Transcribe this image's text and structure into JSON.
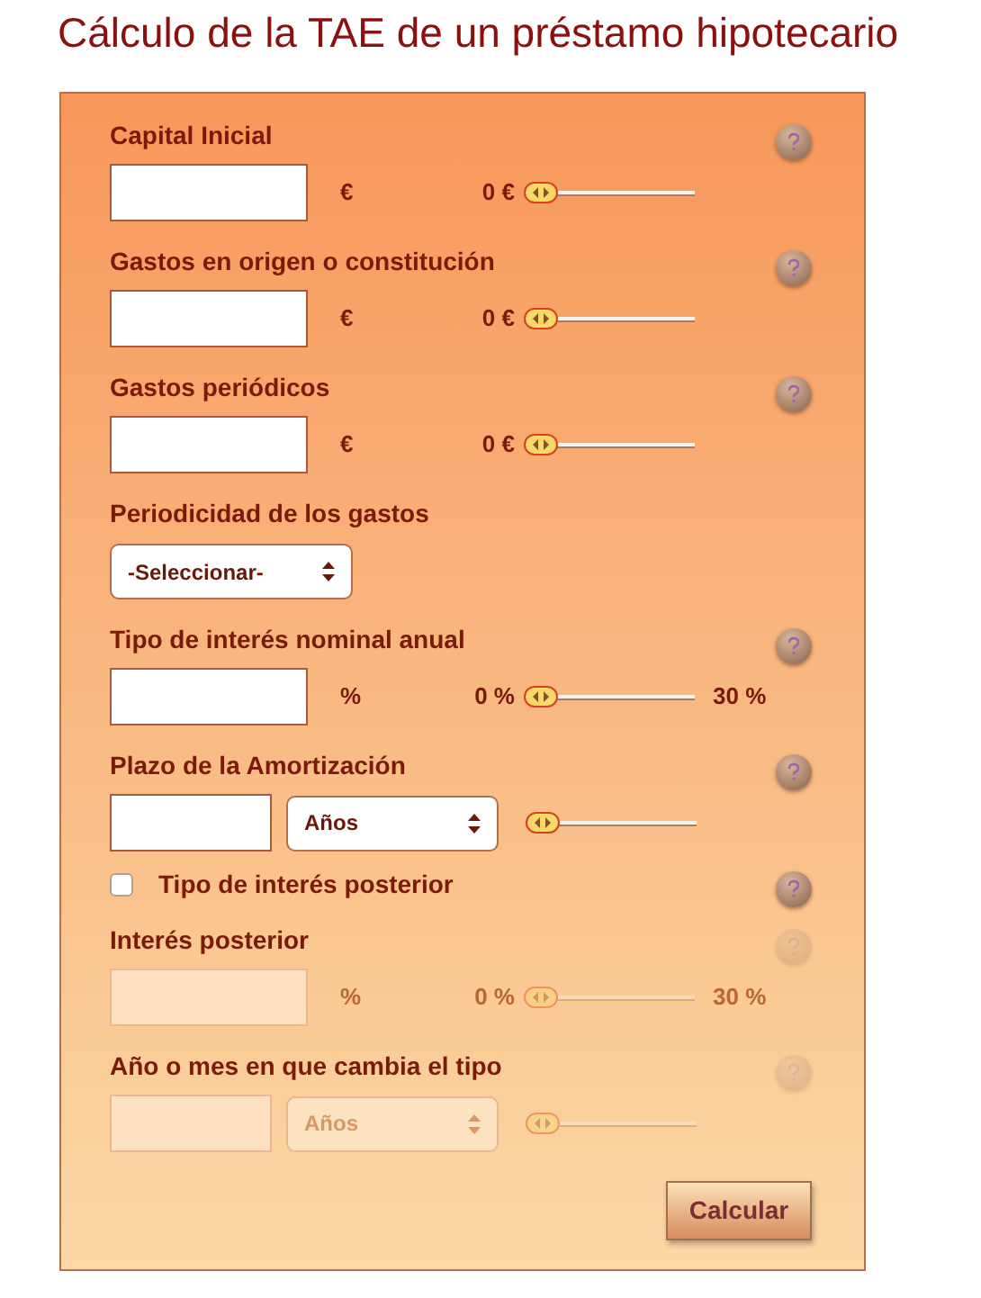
{
  "title": "Cálculo de la TAE de un préstamo hipotecario",
  "fields": [
    {
      "kind": "amount",
      "label": "Capital Inicial",
      "unit": "€",
      "min": "0 €",
      "level": 0,
      "disabled": false,
      "help": true
    },
    {
      "kind": "amount",
      "label": "Gastos en origen o constitución",
      "unit": "€",
      "min": "0 €",
      "level": 0,
      "disabled": false,
      "help": true
    },
    {
      "kind": "amount",
      "label": "Gastos periódicos",
      "unit": "€",
      "min": "0 €",
      "level": 0,
      "disabled": false,
      "help": true
    },
    {
      "kind": "select",
      "label": "Periodicidad de los gastos",
      "value": "-Seleccionar-",
      "disabled": false,
      "help": false
    },
    {
      "kind": "amount",
      "label": "Tipo de interés nominal anual",
      "unit": "%",
      "min": "0 %",
      "max": "30 %",
      "level": 0,
      "disabled": false,
      "help": true
    },
    {
      "kind": "term",
      "label": "Plazo de la Amortización",
      "value": "Años",
      "level": 0,
      "disabled": false,
      "help": true
    },
    {
      "kind": "checkbox",
      "label": "Tipo de interés posterior",
      "checked": false,
      "disabled": false,
      "help": true
    },
    {
      "kind": "amount",
      "label": "Interés posterior",
      "unit": "%",
      "min": "0 %",
      "max": "30 %",
      "level": 0,
      "disabled": true,
      "help": true
    },
    {
      "kind": "term",
      "label": "Año o mes en que cambia el tipo",
      "value": "Años",
      "level": 0,
      "disabled": true,
      "help": true
    }
  ],
  "submit": "Calcular"
}
